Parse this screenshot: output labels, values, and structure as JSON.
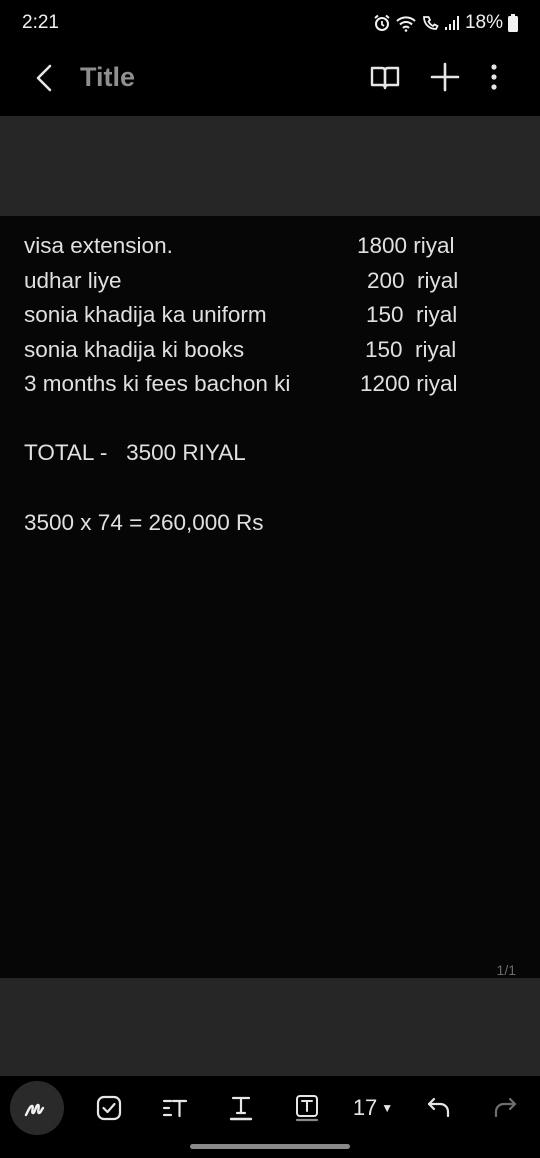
{
  "status": {
    "time": "2:21",
    "battery": "18%"
  },
  "app_bar": {
    "title": "Title"
  },
  "note": {
    "items": [
      {
        "label": "visa extension.",
        "amount": "1800 riyal"
      },
      {
        "label": "udhar liye",
        "amount": "200  riyal"
      },
      {
        "label": "sonia khadija ka uniform",
        "amount": "150  riyal"
      },
      {
        "label": "sonia khadija ki books",
        "amount": "150  riyal"
      },
      {
        "label": "3 months ki fees bachon ki",
        "amount": "1200 riyal"
      }
    ],
    "total": "TOTAL -   3500 RIYAL",
    "conversion": "3500 x 74 = 260,000 Rs",
    "page_counter": "1/1"
  },
  "toolbar": {
    "font_size": "17",
    "icons": [
      "pen-icon",
      "checkbox-icon",
      "text-style-icon",
      "text-format-icon",
      "text-box-icon",
      "undo-icon",
      "redo-icon"
    ]
  }
}
